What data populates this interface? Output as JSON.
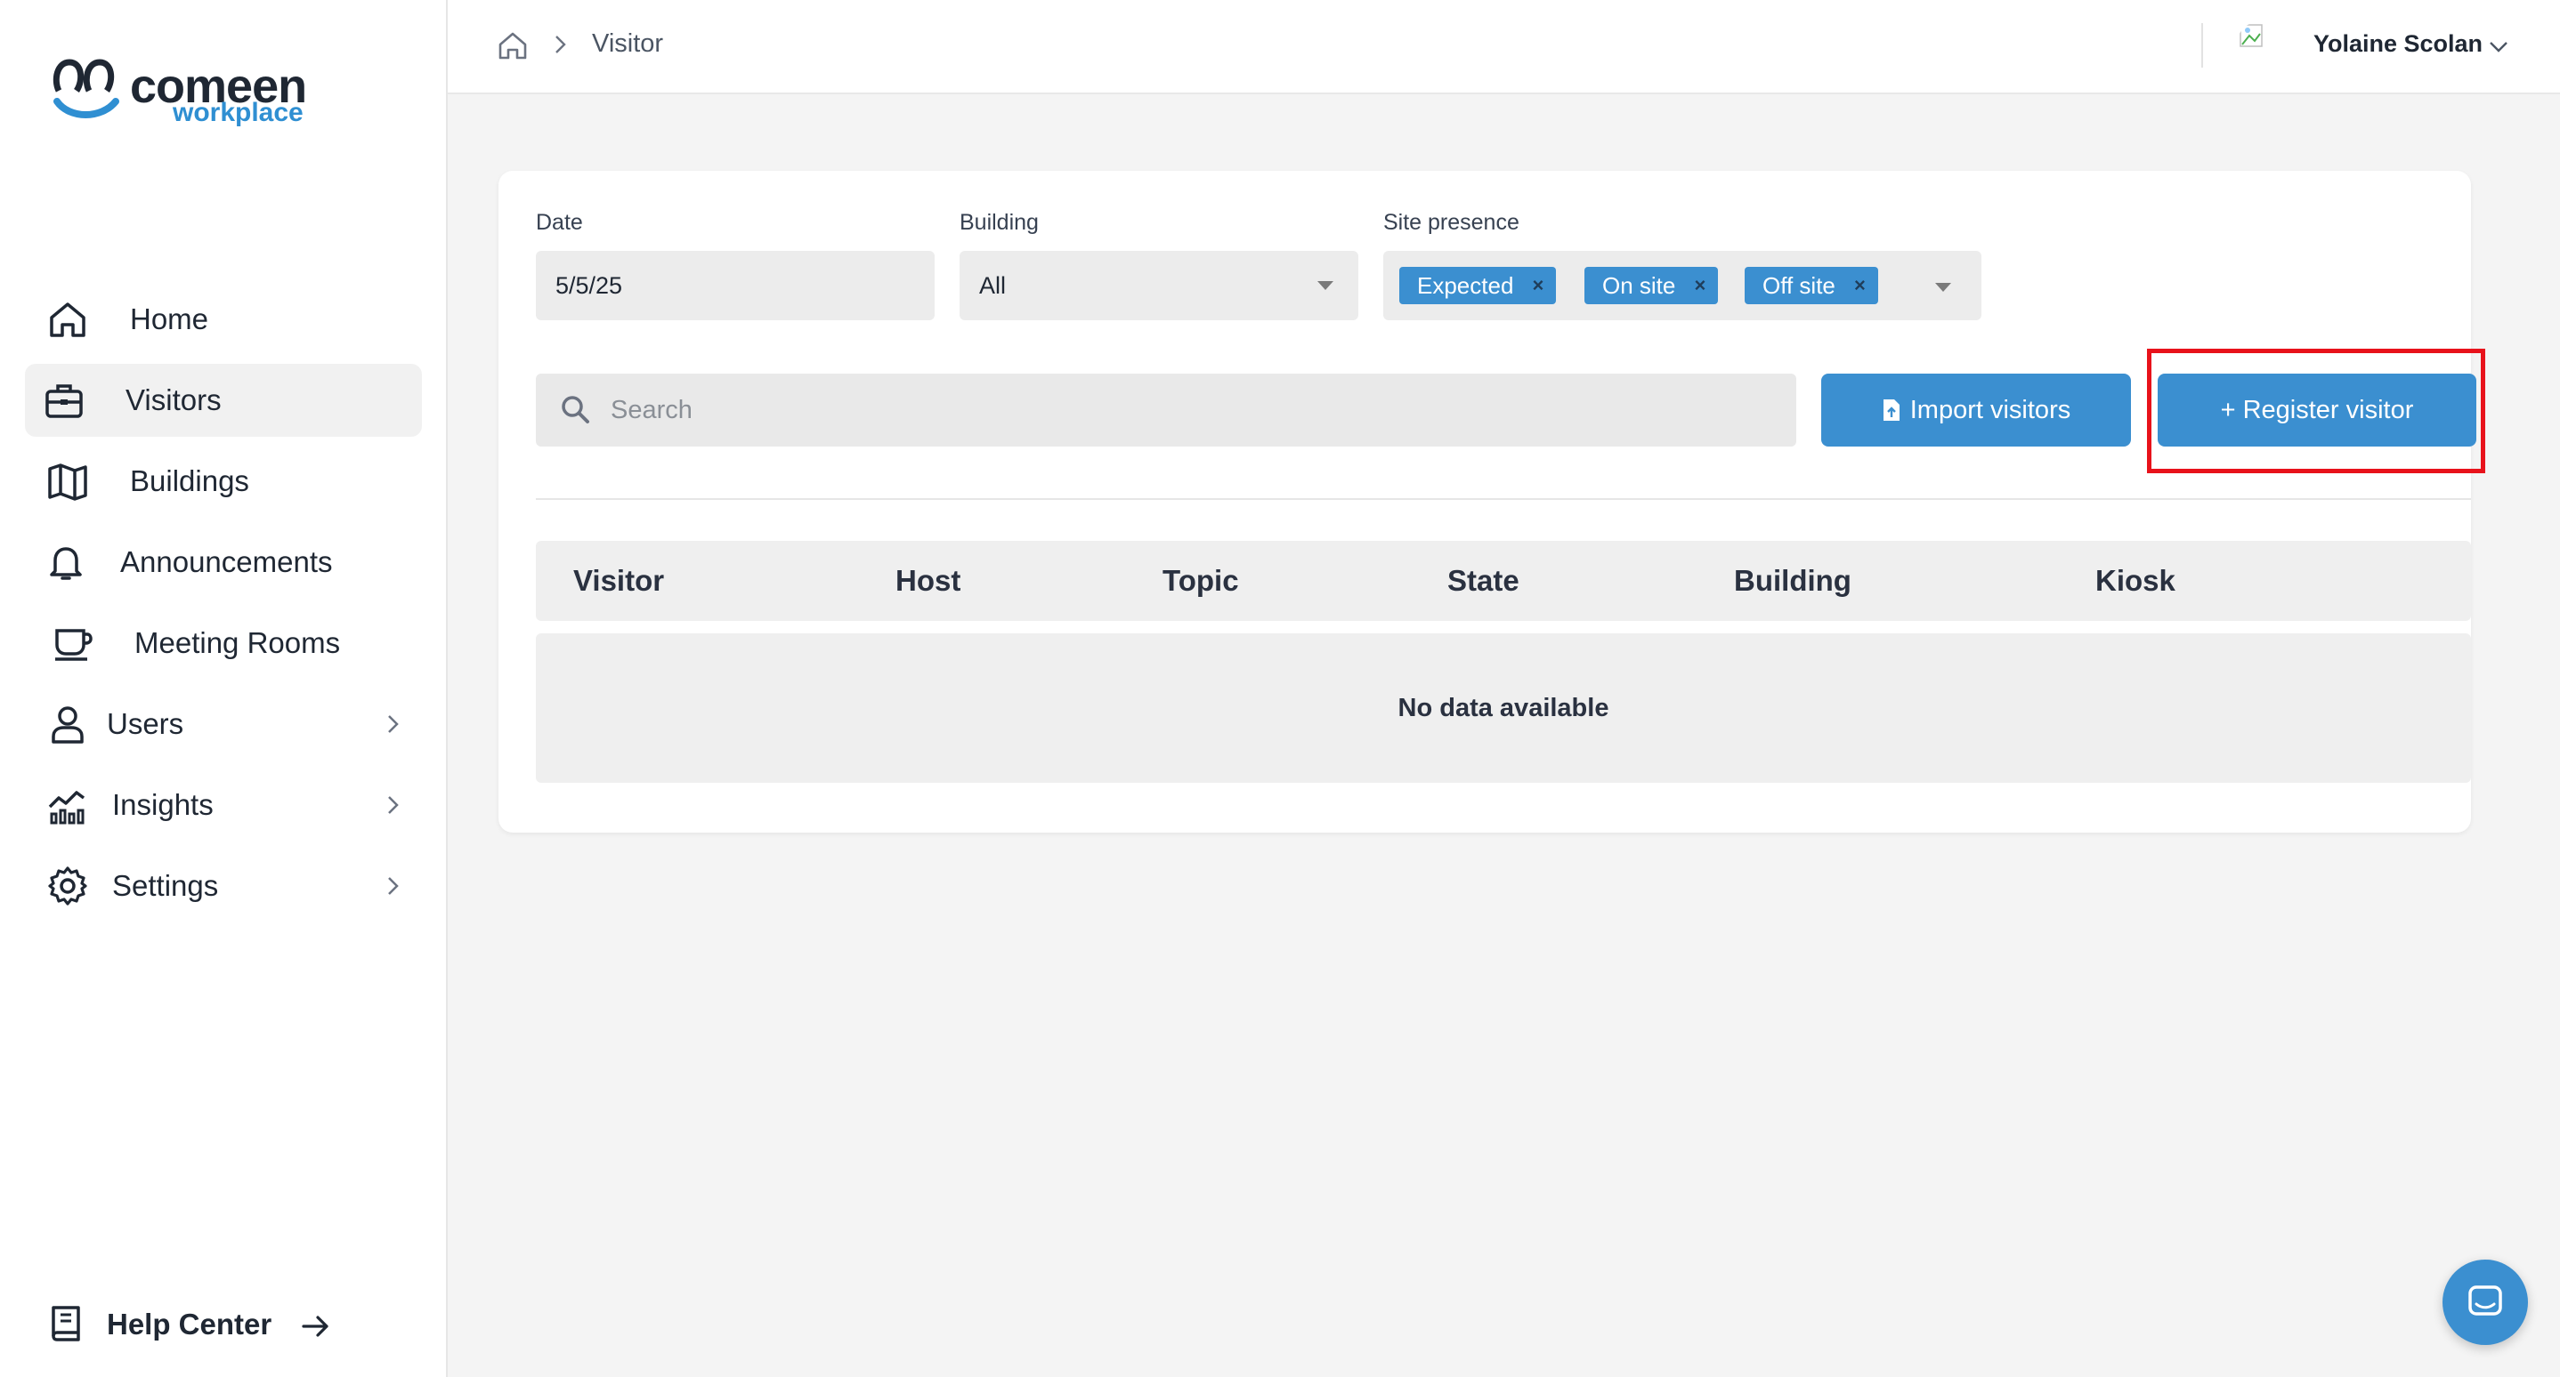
{
  "brand": {
    "name": "comeen",
    "product": "workplace"
  },
  "sidebar": {
    "items": [
      {
        "label": "Home",
        "icon": "home-icon"
      },
      {
        "label": "Visitors",
        "icon": "briefcase-icon",
        "active": true
      },
      {
        "label": "Buildings",
        "icon": "map-icon"
      },
      {
        "label": "Announcements",
        "icon": "bell-icon"
      },
      {
        "label": "Meeting Rooms",
        "icon": "coffee-cup-icon"
      },
      {
        "label": "Users",
        "icon": "user-icon",
        "expandable": true
      },
      {
        "label": "Insights",
        "icon": "chart-icon",
        "expandable": true
      },
      {
        "label": "Settings",
        "icon": "gear-icon",
        "expandable": true
      }
    ],
    "help_label": "Help Center"
  },
  "header": {
    "breadcrumb_current": "Visitor",
    "user_name": "Yolaine Scolan"
  },
  "filters": {
    "date_label": "Date",
    "date_value": "5/5/25",
    "building_label": "Building",
    "building_value": "All",
    "presence_label": "Site presence",
    "presence_chips": [
      "Expected",
      "On site",
      "Off site"
    ]
  },
  "search": {
    "placeholder": "Search"
  },
  "actions": {
    "import_label": "Import visitors",
    "register_label": "+ Register visitor"
  },
  "table": {
    "columns": [
      "Visitor",
      "Host",
      "Topic",
      "State",
      "Building",
      "Kiosk"
    ],
    "empty_message": "No data available"
  },
  "colors": {
    "accent": "#3b8fd0",
    "highlight": "#e8121b"
  }
}
